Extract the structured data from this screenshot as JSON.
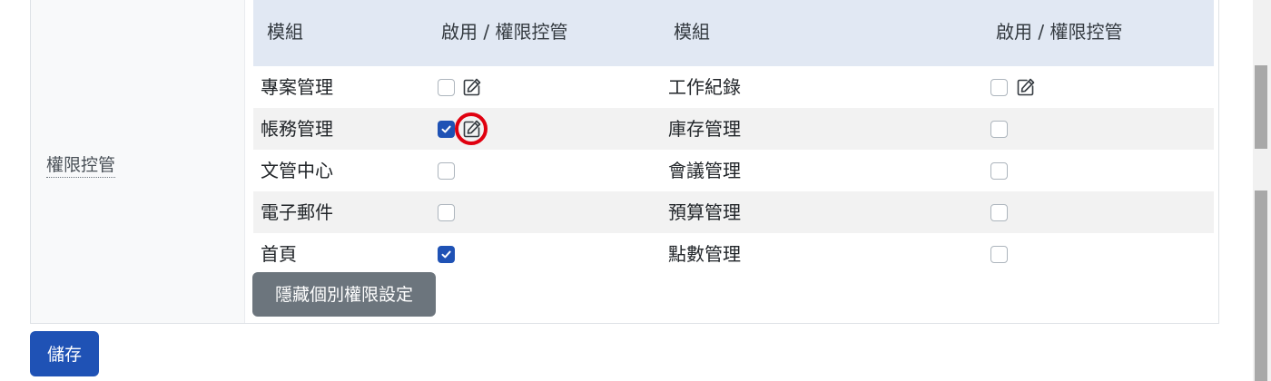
{
  "permission_section": {
    "label": "權限控管",
    "headers": [
      "模組",
      "啟用 / 權限控管",
      "模組",
      "啟用 / 權限控管"
    ],
    "rows": [
      {
        "left_module": "專案管理",
        "left_enabled": false,
        "left_edit_icon": true,
        "right_module": "工作紀錄",
        "right_enabled": false,
        "right_edit_icon": true
      },
      {
        "left_module": "帳務管理",
        "left_enabled": true,
        "left_edit_icon": true,
        "right_module": "庫存管理",
        "right_enabled": false,
        "right_edit_icon": false
      },
      {
        "left_module": "文管中心",
        "left_enabled": false,
        "left_edit_icon": false,
        "right_module": "會議管理",
        "right_enabled": false,
        "right_edit_icon": false
      },
      {
        "left_module": "電子郵件",
        "left_enabled": false,
        "left_edit_icon": false,
        "right_module": "預算管理",
        "right_enabled": false,
        "right_edit_icon": false
      },
      {
        "left_module": "首頁",
        "left_enabled": true,
        "left_edit_icon": false,
        "right_module": "點數管理",
        "right_enabled": false,
        "right_edit_icon": false
      }
    ],
    "hide_button_label": "隱藏個別權限設定"
  },
  "save_button_label": "儲存",
  "icons": {
    "edit": "edit-icon",
    "check": "check-icon"
  },
  "colors": {
    "primary": "#1f52b5",
    "secondary_button": "#6c757d",
    "table_header_bg": "#e1e8f3",
    "highlight_ring": "#e0000f"
  }
}
